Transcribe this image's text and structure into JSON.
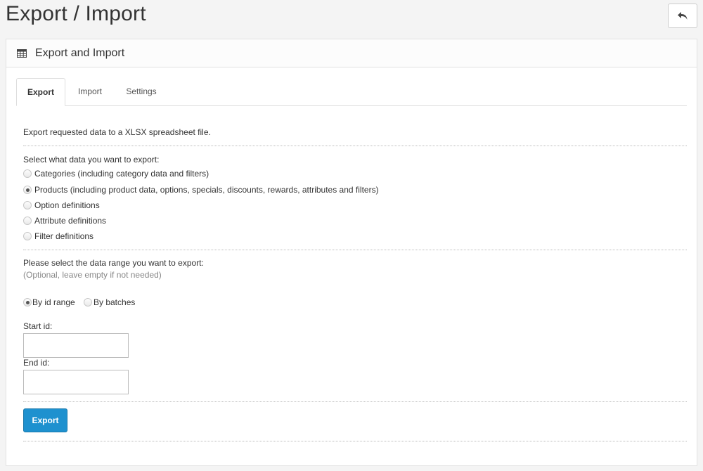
{
  "page": {
    "title": "Export / Import",
    "back_button_icon": "reply-icon"
  },
  "panel": {
    "heading": "Export and Import",
    "heading_icon": "table-icon"
  },
  "tabs": [
    {
      "label": "Export",
      "active": true
    },
    {
      "label": "Import",
      "active": false
    },
    {
      "label": "Settings",
      "active": false
    }
  ],
  "export": {
    "description": "Export requested data to a XLSX spreadsheet file.",
    "select_label": "Select what data you want to export:",
    "data_options": [
      {
        "label": "Categories (including category data and filters)",
        "checked": false
      },
      {
        "label": "Products (including product data, options, specials, discounts, rewards, attributes and filters)",
        "checked": true
      },
      {
        "label": "Option definitions",
        "checked": false
      },
      {
        "label": "Attribute definitions",
        "checked": false
      },
      {
        "label": "Filter definitions",
        "checked": false
      }
    ],
    "range_label": "Please select the data range you want to export:",
    "range_hint": "(Optional, leave empty if not needed)",
    "range_modes": [
      {
        "label": "By id range",
        "checked": true
      },
      {
        "label": "By batches",
        "checked": false
      }
    ],
    "start_id_label": "Start id:",
    "start_id_value": "",
    "end_id_label": "End id:",
    "end_id_value": "",
    "export_button": "Export"
  },
  "colors": {
    "primary_button": "#1e91cf",
    "background": "#f4f4f4"
  }
}
